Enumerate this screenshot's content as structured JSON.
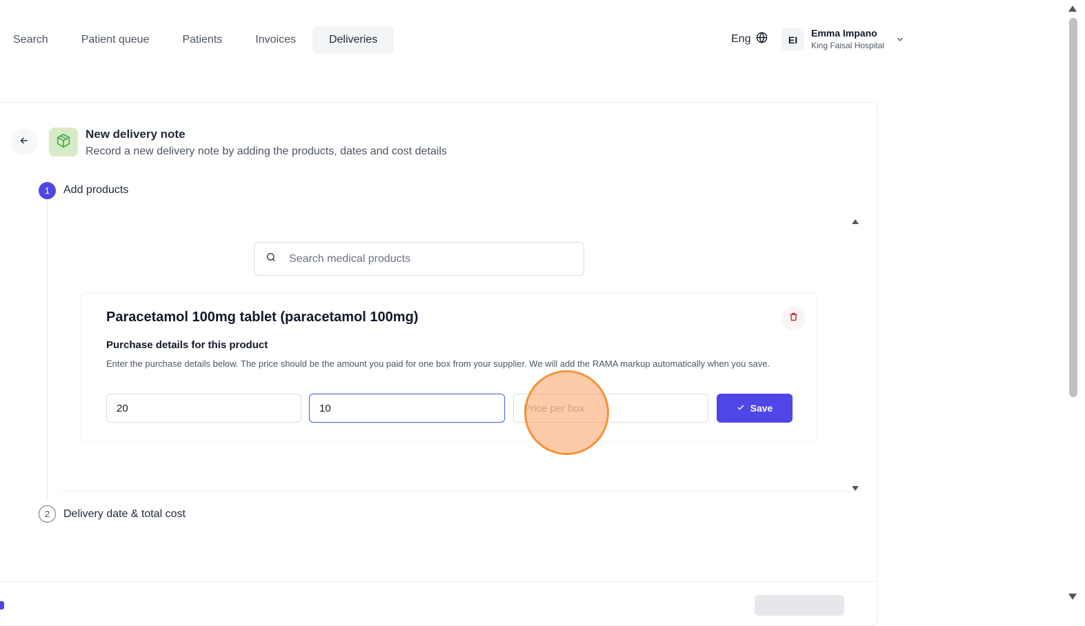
{
  "nav": {
    "tabs": [
      {
        "label": "Search"
      },
      {
        "label": "Patient queue"
      },
      {
        "label": "Patients"
      },
      {
        "label": "Invoices"
      },
      {
        "label": "Deliveries",
        "active": true
      }
    ]
  },
  "header": {
    "language": "Eng",
    "user": {
      "initials": "EI",
      "name": "Emma Impano",
      "organization": "King Faisal Hospital"
    }
  },
  "page": {
    "title": "New delivery note",
    "subtitle": "Record a new delivery note by adding the products, dates and cost details"
  },
  "steps": [
    {
      "number": "1",
      "label": "Add products",
      "state": "active"
    },
    {
      "number": "2",
      "label": "Delivery date & total cost",
      "state": "pending"
    }
  ],
  "search": {
    "placeholder": "Search medical products"
  },
  "product": {
    "title": "Paracetamol 100mg tablet (paracetamol 100mg)",
    "details_title": "Purchase details for this product",
    "details_description": "Enter the purchase details below. The price should be the amount you paid for one box from your supplier. We will add the RAMA markup automatically when you save.",
    "fields": [
      {
        "value": "20",
        "placeholder": ""
      },
      {
        "value": "10",
        "placeholder": ""
      },
      {
        "value": "",
        "placeholder": "Price per box"
      }
    ],
    "save_label": "Save"
  },
  "colors": {
    "accent": "#4f46e5",
    "focus_border": "#4f6bd8",
    "box_icon_bg": "#d7ebc8",
    "box_icon": "#4caf50",
    "trash": "#c62828",
    "click_marker": "#f59235"
  },
  "icons": {
    "language": "globe-icon",
    "user_menu": "chevron-down-icon",
    "back": "arrow-left-icon",
    "product_type": "box-icon",
    "search": "search-icon",
    "delete": "trash-icon",
    "save": "check-icon"
  }
}
